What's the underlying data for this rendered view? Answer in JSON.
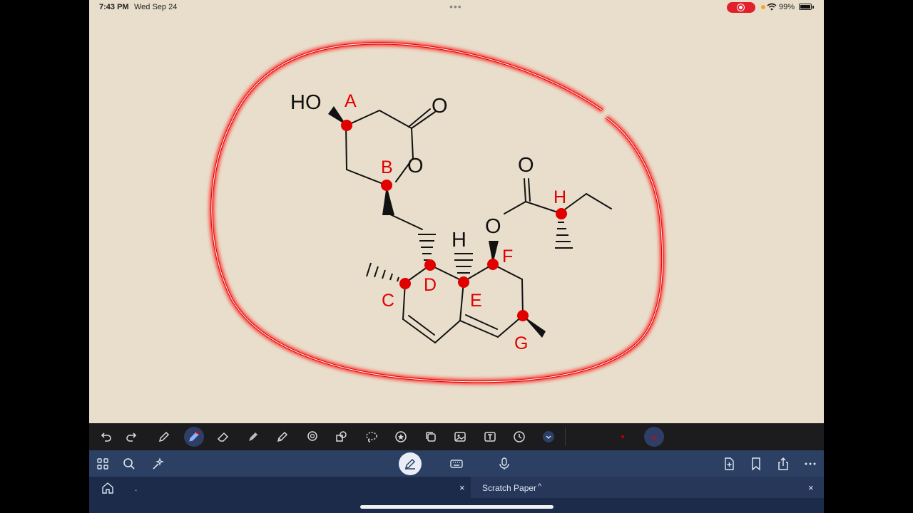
{
  "status_bar": {
    "time": "7:43 PM",
    "date": "Wed Sep 24",
    "battery": "99%",
    "battery_level": 0.99,
    "recording": true
  },
  "canvas": {
    "labels": [
      "A",
      "B",
      "C",
      "D",
      "E",
      "F",
      "G",
      "H"
    ],
    "atoms": {
      "ho": "HO",
      "o1": "O",
      "o2": "O",
      "o3": "O",
      "o4": "O",
      "o5": "O",
      "h1": "H"
    }
  },
  "colors": {
    "paper": "#e8decb",
    "ink": "#111111",
    "mark": "#e00000",
    "toolbar": "#1c1c1e",
    "navbar": "#2c4063",
    "tabbar": "#1d2b4a"
  },
  "toolbar": {
    "icons": [
      "undo-icon",
      "redo-icon",
      "pen-icon",
      "pen-icon",
      "eraser-icon",
      "highlighter-icon",
      "pencil-icon",
      "lasso-icon",
      "shapes-icon",
      "lasso-icon",
      "sticker-icon",
      "copy-icon",
      "image-icon",
      "text-icon",
      "clock-icon",
      "chevron-down-icon"
    ]
  },
  "navbar": {
    "icons": [
      "grid-icon",
      "search-icon",
      "sparkle-icon",
      "pencil-icon",
      "keyboard-icon",
      "mic-icon",
      "add-page-icon",
      "bookmark-icon",
      "share-icon",
      "more-icon"
    ]
  },
  "tabs": {
    "first_tab_label": ".",
    "second_tab_label": "Scratch Paper"
  }
}
